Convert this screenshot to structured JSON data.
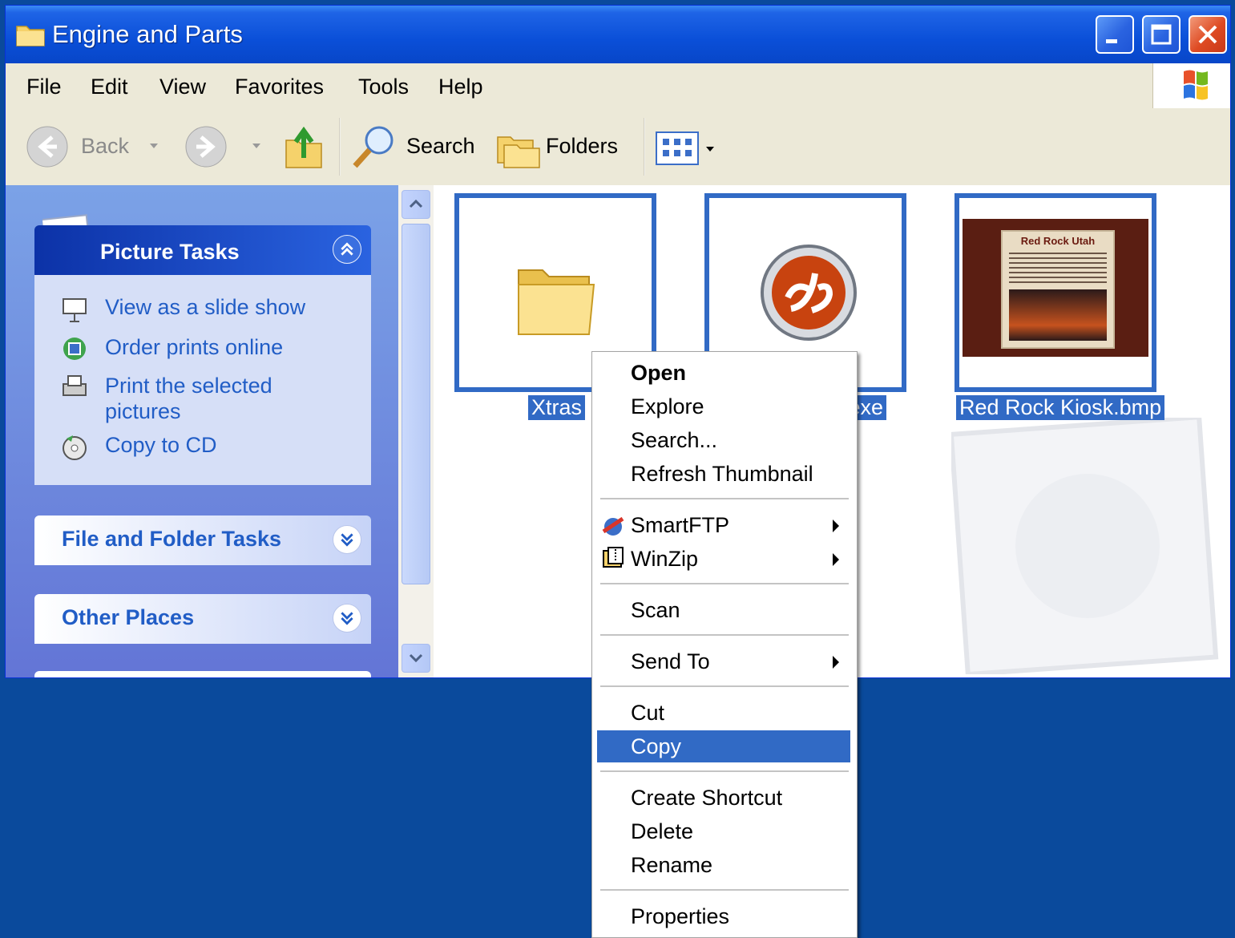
{
  "window": {
    "title": "Engine and Parts"
  },
  "menubar": {
    "items": [
      "File",
      "Edit",
      "View",
      "Favorites",
      "Tools",
      "Help"
    ]
  },
  "toolbar": {
    "back_label": "Back",
    "search_label": "Search",
    "folders_label": "Folders"
  },
  "taskpane": {
    "picture_tasks": {
      "title": "Picture Tasks",
      "items": [
        "View as a slide show",
        "Order prints online",
        "Print the selected",
        "pictures",
        "Copy to CD"
      ]
    },
    "file_folder_tasks": {
      "title": "File and Folder Tasks"
    },
    "other_places": {
      "title": "Other Places"
    }
  },
  "files": [
    {
      "name": "Xtras",
      "kind": "folder"
    },
    {
      "name": ".exe",
      "kind": "director-exe"
    },
    {
      "name": "Red Rock Kiosk.bmp",
      "kind": "bitmap",
      "thumb_title": "Red Rock Utah"
    }
  ],
  "context_menu": {
    "items": [
      "Open",
      "Explore",
      "Search...",
      "Refresh Thumbnail",
      "SmartFTP",
      "WinZip",
      "Scan",
      "Send To",
      "Cut",
      "Copy",
      "Create Shortcut",
      "Delete",
      "Rename",
      "Properties"
    ],
    "highlighted": "Copy"
  },
  "colors": {
    "titlebar": "#0a4fd8",
    "selection": "#316ac5",
    "desktop": "#0a4a9c",
    "task_link": "#215dc6"
  }
}
